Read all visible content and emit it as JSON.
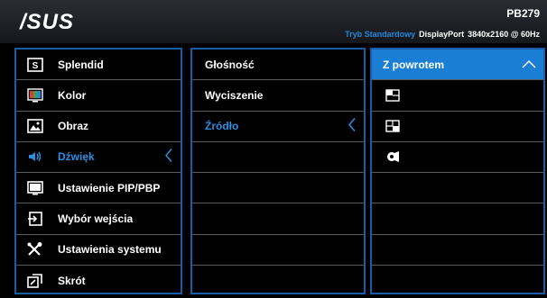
{
  "header": {
    "logo": "/SUS",
    "model": "PB279",
    "mode": "Tryb Standardowy",
    "input": "DisplayPort",
    "resolution": "3840x2160 @ 60Hz"
  },
  "main_menu": [
    {
      "label": "Splendid",
      "icon": "splendid-icon"
    },
    {
      "label": "Kolor",
      "icon": "color-icon"
    },
    {
      "label": "Obraz",
      "icon": "image-icon"
    },
    {
      "label": "Dźwięk",
      "icon": "speaker-icon",
      "active": true
    },
    {
      "label": "Ustawienie PIP/PBP",
      "icon": "pip-icon"
    },
    {
      "label": "Wybór wejścia",
      "icon": "input-icon"
    },
    {
      "label": "Ustawienia systemu",
      "icon": "tools-icon"
    },
    {
      "label": "Skrót",
      "icon": "shortcut-icon"
    }
  ],
  "sub_menu": [
    {
      "label": "Głośność"
    },
    {
      "label": "Wyciszenie"
    },
    {
      "label": "Źródło",
      "active": true
    }
  ],
  "options": {
    "back_label": "Z powrotem",
    "items": [
      "pip-window-icon",
      "pbp-window-icon",
      "source-icon"
    ]
  },
  "colors": {
    "accent": "#1a7ed4",
    "border": "#1a5ca8",
    "active_text": "#2d8fe0"
  }
}
